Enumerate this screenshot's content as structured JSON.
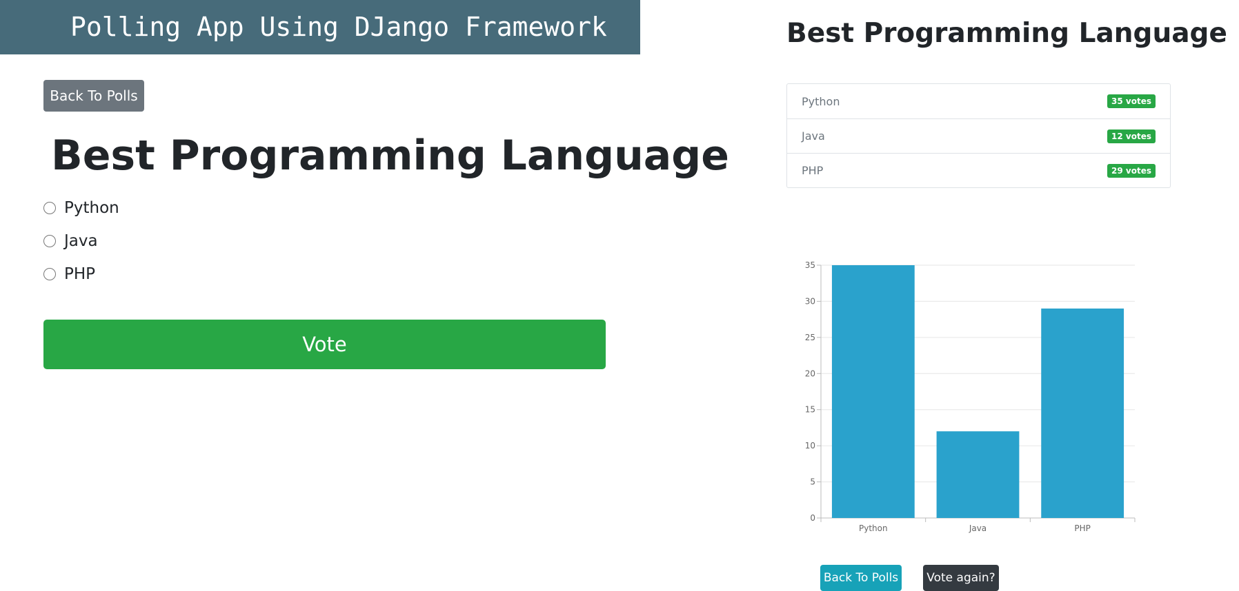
{
  "header": {
    "title": "Polling App Using DJango Framework"
  },
  "poll": {
    "back_label": "Back To Polls",
    "question": "Best Programming Language",
    "choices": [
      {
        "label": "Python"
      },
      {
        "label": "Java"
      },
      {
        "label": "PHP"
      }
    ],
    "vote_label": "Vote"
  },
  "results": {
    "title": "Best Programming Language",
    "items": [
      {
        "name": "Python",
        "votes": "35 votes"
      },
      {
        "name": "Java",
        "votes": "12 votes"
      },
      {
        "name": "PHP",
        "votes": "29 votes"
      }
    ],
    "back_label": "Back To Polls",
    "vote_again_label": "Vote again?"
  },
  "colors": {
    "banner": "#476b7a",
    "vote": "#28a745",
    "badge": "#28a745",
    "bar": "#2aa2cc",
    "back_secondary": "#6c757d",
    "back_info": "#17a2b8",
    "dark": "#343a40"
  },
  "chart_data": {
    "type": "bar",
    "categories": [
      "Python",
      "Java",
      "PHP"
    ],
    "values": [
      35,
      12,
      29
    ],
    "ylim": [
      0,
      35
    ],
    "yticks": [
      0,
      5,
      10,
      15,
      20,
      25,
      30,
      35
    ],
    "grid": true,
    "title": "",
    "xlabel": "",
    "ylabel": ""
  }
}
